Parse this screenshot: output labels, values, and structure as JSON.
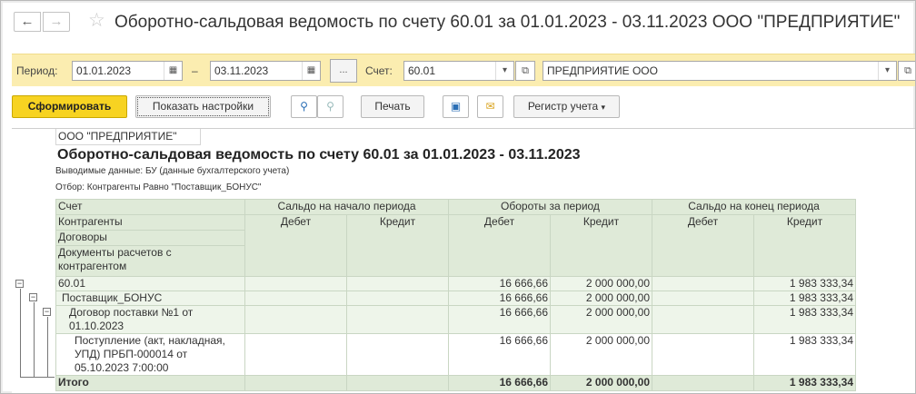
{
  "title": "Оборотно-сальдовая ведомость по счету 60.01 за 01.01.2023 - 03.11.2023 ООО \"ПРЕДПРИЯТИЕ\"",
  "nav": {
    "back_icon": "arrow-left-icon",
    "forward_icon": "arrow-right-icon",
    "favorite_icon": "star-icon"
  },
  "params": {
    "period_label": "Период:",
    "date_from": "01.01.2023",
    "dash": "–",
    "date_to": "03.11.2023",
    "more_label": "...",
    "account_label": "Счет:",
    "account_value": "60.01",
    "org_value": "ПРЕДПРИЯТИЕ ООО"
  },
  "toolbar": {
    "generate_label": "Сформировать",
    "settings_label": "Показать настройки",
    "print_label": "Печать",
    "register_label": "Регистр учета"
  },
  "report": {
    "org": "ООО \"ПРЕДПРИЯТИЕ\"",
    "title": "Оборотно-сальдовая ведомость по счету 60.01 за 01.01.2023 - 03.11.2023",
    "output_line": "Выводимые данные: БУ (данные бухгалтерского учета)",
    "filter_line": "Отбор: Контрагенты Равно \"Поставщик_БОНУС\"",
    "header": {
      "account": "Счет",
      "counterparties": "Контрагенты",
      "contracts": "Договоры",
      "documents": "Документы расчетов с контрагентом",
      "opening": "Сальдо на начало периода",
      "turnover": "Обороты за период",
      "closing": "Сальдо на конец периода",
      "debit": "Дебет",
      "credit": "Кредит"
    },
    "rows": [
      {
        "name": "60.01",
        "open_d": "",
        "open_c": "",
        "turn_d": "16 666,66",
        "turn_c": "2 000 000,00",
        "close_d": "",
        "close_c": "1 983 333,34"
      },
      {
        "name": "Поставщик_БОНУС",
        "open_d": "",
        "open_c": "",
        "turn_d": "16 666,66",
        "turn_c": "2 000 000,00",
        "close_d": "",
        "close_c": "1 983 333,34"
      },
      {
        "name": "Договор поставки №1 от 01.10.2023",
        "open_d": "",
        "open_c": "",
        "turn_d": "16 666,66",
        "turn_c": "2 000 000,00",
        "close_d": "",
        "close_c": "1 983 333,34"
      },
      {
        "name": "Поступление (акт, накладная, УПД) ПРБП-000014 от 05.10.2023 7:00:00",
        "open_d": "",
        "open_c": "",
        "turn_d": "16 666,66",
        "turn_c": "2 000 000,00",
        "close_d": "",
        "close_c": "1 983 333,34"
      }
    ],
    "total": {
      "name": "Итого",
      "turn_d": "16 666,66",
      "turn_c": "2 000 000,00",
      "close_c": "1 983 333,34"
    }
  },
  "colors": {
    "param_bar": "#fbedb0",
    "primary_button": "#f7d322",
    "table_header": "#dfead8",
    "table_border": "#c9d6c3"
  }
}
